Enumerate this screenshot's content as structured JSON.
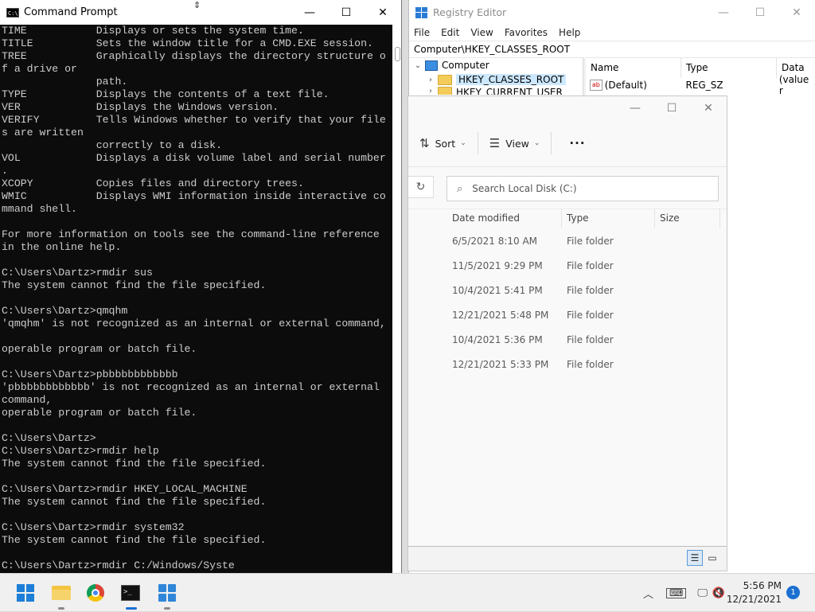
{
  "cmd": {
    "title": "Command Prompt",
    "lines": [
      "TIME           Displays or sets the system time.",
      "TITLE          Sets the window title for a CMD.EXE session.",
      "TREE           Graphically displays the directory structure o",
      "f a drive or",
      "               path.",
      "TYPE           Displays the contents of a text file.",
      "VER            Displays the Windows version.",
      "VERIFY         Tells Windows whether to verify that your file",
      "s are written",
      "               correctly to a disk.",
      "VOL            Displays a disk volume label and serial number",
      ".",
      "XCOPY          Copies files and directory trees.",
      "WMIC           Displays WMI information inside interactive co",
      "mmand shell.",
      "",
      "For more information on tools see the command-line reference",
      "in the online help.",
      "",
      "C:\\Users\\Dartz>rmdir sus",
      "The system cannot find the file specified.",
      "",
      "C:\\Users\\Dartz>qmqhm",
      "'qmqhm' is not recognized as an internal or external command,",
      "",
      "operable program or batch file.",
      "",
      "C:\\Users\\Dartz>pbbbbbbbbbbbb",
      "'pbbbbbbbbbbbb' is not recognized as an internal or external",
      "command,",
      "operable program or batch file.",
      "",
      "C:\\Users\\Dartz>",
      "C:\\Users\\Dartz>rmdir help",
      "The system cannot find the file specified.",
      "",
      "C:\\Users\\Dartz>rmdir HKEY_LOCAL_MACHINE",
      "The system cannot find the file specified.",
      "",
      "C:\\Users\\Dartz>rmdir system32",
      "The system cannot find the file specified.",
      "",
      "C:\\Users\\Dartz>rmdir C:/Windows/Syste"
    ]
  },
  "registry": {
    "title": "Registry Editor",
    "menu": [
      "File",
      "Edit",
      "View",
      "Favorites",
      "Help"
    ],
    "address": "Computer\\HKEY_CLASSES_ROOT",
    "tree": {
      "root": "Computer",
      "items": [
        "HKEY_CLASSES_ROOT",
        "HKEY_CURRENT_USER"
      ]
    },
    "columns": [
      "Name",
      "Type",
      "Data"
    ],
    "row": {
      "name": "(Default)",
      "type": "REG_SZ",
      "data": "(value r"
    }
  },
  "explorer": {
    "toolbar": {
      "sort": "Sort",
      "view": "View",
      "more": "···"
    },
    "search_placeholder": "Search Local Disk (C:)",
    "columns": [
      "Date modified",
      "Type",
      "Size"
    ],
    "rows": [
      {
        "date": "6/5/2021 8:10 AM",
        "type": "File folder"
      },
      {
        "date": "11/5/2021 9:29 PM",
        "type": "File folder"
      },
      {
        "date": "10/4/2021 5:41 PM",
        "type": "File folder"
      },
      {
        "date": "12/21/2021 5:48 PM",
        "type": "File folder"
      },
      {
        "date": "10/4/2021 5:36 PM",
        "type": "File folder"
      },
      {
        "date": "12/21/2021 5:33 PM",
        "type": "File folder"
      }
    ]
  },
  "taskbar": {
    "time": "5:56 PM",
    "date": "12/21/2021",
    "notifications": "1",
    "apps": [
      "start-icon",
      "file-explorer-icon",
      "chrome-icon",
      "command-prompt-icon",
      "registry-editor-icon"
    ]
  }
}
